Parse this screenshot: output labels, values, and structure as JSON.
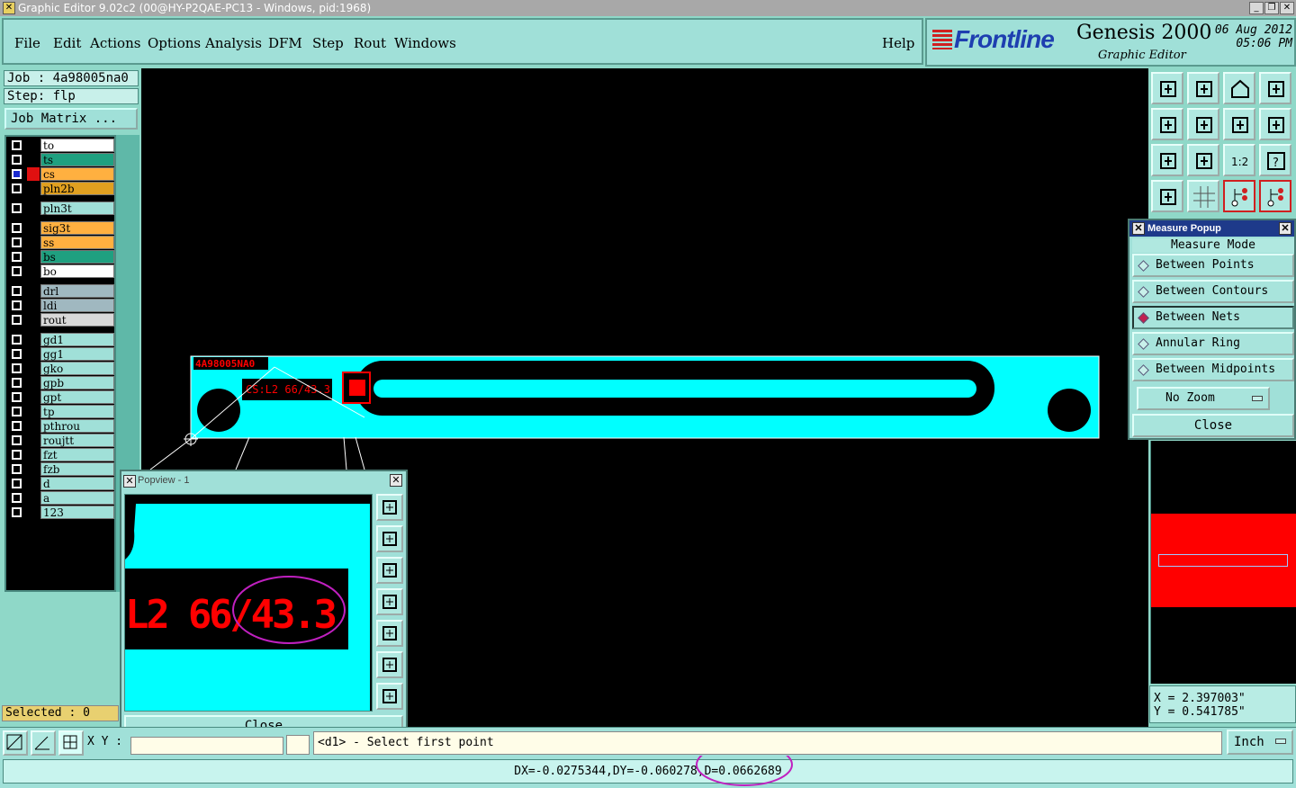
{
  "window": {
    "title": "Graphic Editor 9.02c2 (00@HY-P2QAE-PC13 - Windows, pid:1968)"
  },
  "menu": [
    "File",
    "Edit",
    "Actions",
    "Options",
    "Analysis",
    "DFM",
    "Step",
    "Rout",
    "Windows"
  ],
  "help_label": "Help",
  "brand": {
    "logo": "Frontline",
    "product": "Genesis 2000",
    "subtitle": "Graphic Editor",
    "date": "06 Aug 2012",
    "time": "05:06 PM"
  },
  "job": {
    "job_label": "Job : 4a98005na0",
    "step_label": "Step: flp",
    "matrix_button": "Job Matrix ..."
  },
  "layers": [
    {
      "name": "to",
      "color": "#ffffff",
      "checked": false
    },
    {
      "name": "ts",
      "color": "#1fa080",
      "checked": false
    },
    {
      "name": "cs",
      "color": "#ffb040",
      "checked": true,
      "active": true
    },
    {
      "name": "pln2b",
      "color": "#e0a020",
      "checked": false
    },
    {
      "name": "pln3t",
      "color": "#a0e0d8",
      "checked": false
    },
    {
      "name": "sig3t",
      "color": "#ffb040",
      "checked": false
    },
    {
      "name": "ss",
      "color": "#ffb040",
      "checked": false
    },
    {
      "name": "bs",
      "color": "#1fa080",
      "checked": false
    },
    {
      "name": "bo",
      "color": "#ffffff",
      "checked": false
    },
    {
      "name": "drl",
      "color": "#a0b8c0",
      "checked": false
    },
    {
      "name": "ldi",
      "color": "#a0b8c0",
      "checked": false
    },
    {
      "name": "rout",
      "color": "#d8d8d8",
      "checked": false
    },
    {
      "name": "gd1",
      "color": "#a0e0d8",
      "checked": false
    },
    {
      "name": "gg1",
      "color": "#a0e0d8",
      "checked": false
    },
    {
      "name": "gko",
      "color": "#a0e0d8",
      "checked": false
    },
    {
      "name": "gpb",
      "color": "#a0e0d8",
      "checked": false
    },
    {
      "name": "gpt",
      "color": "#a0e0d8",
      "checked": false
    },
    {
      "name": "tp",
      "color": "#a0e0d8",
      "checked": false
    },
    {
      "name": "pthrou",
      "color": "#a0e0d8",
      "checked": false
    },
    {
      "name": "roujtt",
      "color": "#a0e0d8",
      "checked": false
    },
    {
      "name": "fzt",
      "color": "#a0e0d8",
      "checked": false
    },
    {
      "name": "fzb",
      "color": "#a0e0d8",
      "checked": false
    },
    {
      "name": "d",
      "color": "#a0e0d8",
      "checked": false
    },
    {
      "name": "a",
      "color": "#a0e0d8",
      "checked": false
    },
    {
      "name": "123",
      "color": "#a0e0d8",
      "checked": false
    }
  ],
  "selected_label": "Selected : 0",
  "board": {
    "id_text": "4A98005NA0",
    "label_text": "CS:L2 66/43.3"
  },
  "measure_popup": {
    "title": "Measure Popup",
    "heading": "Measure Mode",
    "modes": [
      {
        "label": "Between Points",
        "active": false
      },
      {
        "label": "Between Contours",
        "active": false
      },
      {
        "label": "Between Nets",
        "active": true
      },
      {
        "label": "Annular Ring",
        "active": false
      },
      {
        "label": "Between Midpoints",
        "active": false
      }
    ],
    "zoom_option": "No Zoom",
    "close_label": "Close"
  },
  "popview": {
    "title": "Popview - 1",
    "zoom_text": "L2 66/43.3",
    "close_label": "Close"
  },
  "coords": {
    "x": "X = 2.397003\"",
    "y": "Y = 0.541785\""
  },
  "bottom": {
    "xy_label": "X Y :",
    "xy_value": "",
    "prompt": "<d1> - Select first point",
    "unit": "Inch"
  },
  "status": "DX=-0.0275344,DY=-0.060278,D=0.0662689",
  "colors": {
    "board": "#00ffff",
    "copper": "#ff0000",
    "panel": "#a0e0d8",
    "canvas": "#000000"
  }
}
